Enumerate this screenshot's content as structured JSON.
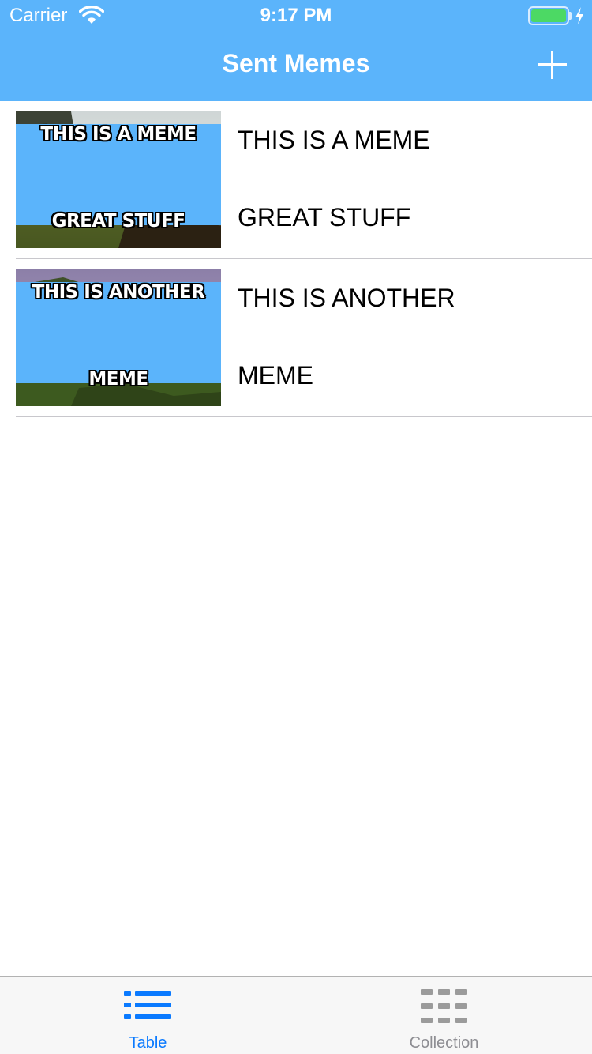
{
  "status_bar": {
    "carrier": "Carrier",
    "time": "9:17 PM",
    "battery_level": 1.0
  },
  "nav": {
    "title": "Sent Memes",
    "add_icon": "plus-icon"
  },
  "memes": [
    {
      "image_top": "THIS IS A MEME",
      "image_bottom": "GREAT STUFF",
      "top_text": "THIS IS A MEME",
      "bottom_text": "GREAT STUFF"
    },
    {
      "image_top": "THIS IS ANOTHER",
      "image_bottom": "MEME",
      "top_text": "THIS IS ANOTHER",
      "bottom_text": "MEME"
    }
  ],
  "tabs": [
    {
      "label": "Table",
      "icon": "list-icon",
      "selected": true
    },
    {
      "label": "Collection",
      "icon": "grid-icon",
      "selected": false
    }
  ],
  "colors": {
    "nav_bar": "#5bb4fb",
    "tab_selected": "#0a7aff",
    "tab_unselected": "#8e8e93",
    "battery": "#4cd964"
  }
}
